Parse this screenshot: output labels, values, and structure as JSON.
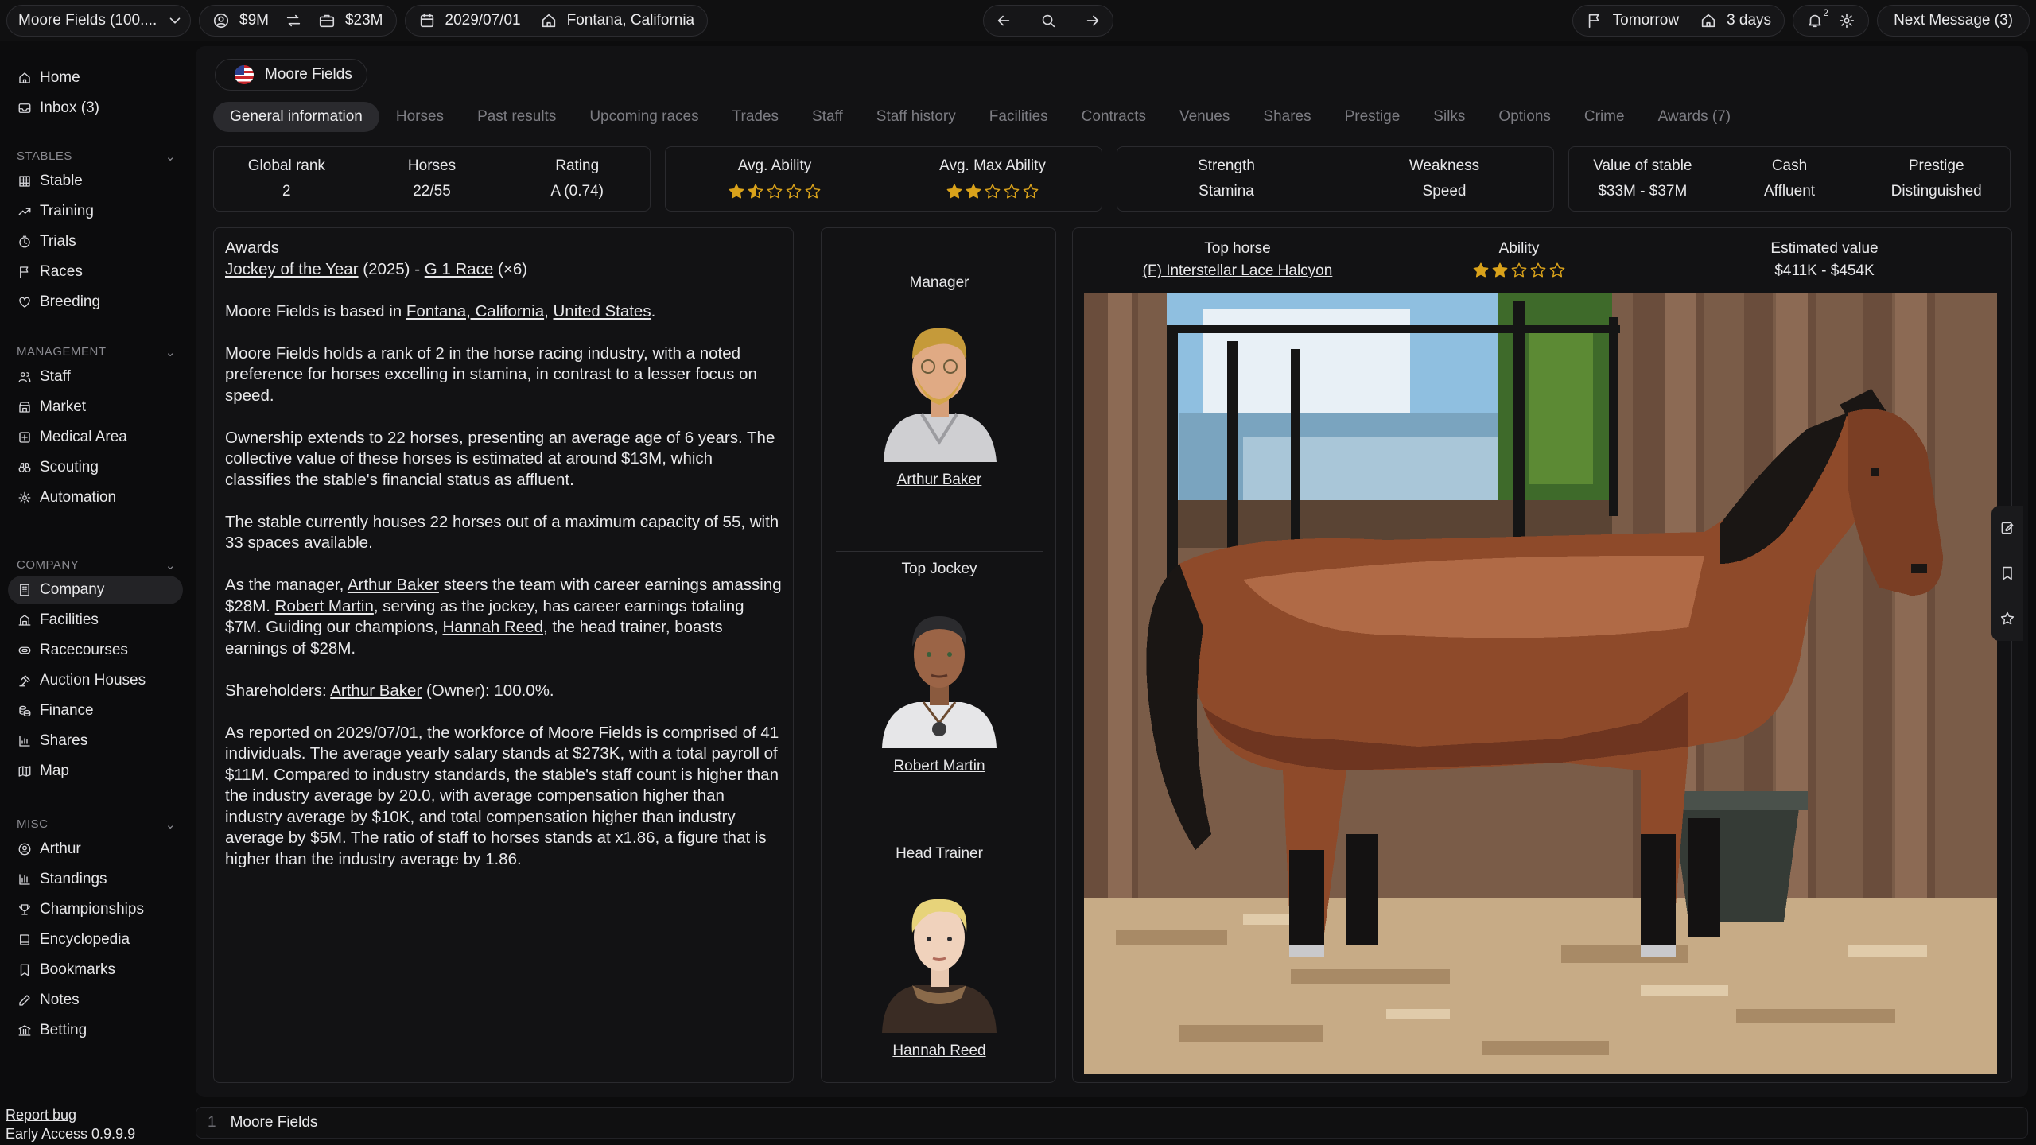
{
  "topbar": {
    "stable_select": "Moore Fields (100....",
    "money": "$9M",
    "stable_value": "$23M",
    "date": "2029/07/01",
    "location": "Fontana, California",
    "forecast": "Tomorrow",
    "days": "3 days",
    "notifications": "2",
    "next_message": "Next Message (3)"
  },
  "sidebar": {
    "top": [
      {
        "label": "Home",
        "icon": "home-icon"
      },
      {
        "label": "Inbox (3)",
        "icon": "inbox-icon"
      }
    ],
    "sections": [
      {
        "title": "STABLES",
        "items": [
          {
            "label": "Stable",
            "icon": "grid-icon"
          },
          {
            "label": "Training",
            "icon": "trend-icon"
          },
          {
            "label": "Trials",
            "icon": "stopwatch-icon"
          },
          {
            "label": "Races",
            "icon": "flag-icon"
          },
          {
            "label": "Breeding",
            "icon": "heart-icon"
          }
        ]
      },
      {
        "title": "MANAGEMENT",
        "items": [
          {
            "label": "Staff",
            "icon": "users-icon"
          },
          {
            "label": "Market",
            "icon": "store-icon"
          },
          {
            "label": "Medical Area",
            "icon": "medical-icon"
          },
          {
            "label": "Scouting",
            "icon": "binoculars-icon"
          },
          {
            "label": "Automation",
            "icon": "cog-icon"
          }
        ]
      },
      {
        "title": "COMPANY",
        "items": [
          {
            "label": "Company",
            "icon": "building-icon"
          },
          {
            "label": "Facilities",
            "icon": "facilities-icon"
          },
          {
            "label": "Racecourses",
            "icon": "racecourse-icon"
          },
          {
            "label": "Auction Houses",
            "icon": "gavel-icon"
          },
          {
            "label": "Finance",
            "icon": "coins-icon"
          },
          {
            "label": "Shares",
            "icon": "chart-icon"
          },
          {
            "label": "Map",
            "icon": "map-icon"
          }
        ]
      },
      {
        "title": "MISC",
        "items": [
          {
            "label": "Arthur",
            "icon": "user-circle-icon"
          },
          {
            "label": "Standings",
            "icon": "standings-icon"
          },
          {
            "label": "Championships",
            "icon": "trophy-icon"
          },
          {
            "label": "Encyclopedia",
            "icon": "book-icon"
          },
          {
            "label": "Bookmarks",
            "icon": "bookmark-icon"
          },
          {
            "label": "Notes",
            "icon": "note-icon"
          },
          {
            "label": "Betting",
            "icon": "bank-icon"
          }
        ]
      }
    ],
    "report_bug": "Report bug",
    "version": "Early Access 0.9.9.9"
  },
  "stable_chip": "Moore Fields",
  "tabs": [
    "General information",
    "Horses",
    "Past results",
    "Upcoming races",
    "Trades",
    "Staff",
    "Staff history",
    "Facilities",
    "Contracts",
    "Venues",
    "Shares",
    "Prestige",
    "Silks",
    "Options",
    "Crime",
    "Awards (7)"
  ],
  "stats": {
    "global_rank_label": "Global rank",
    "global_rank": "2",
    "horses_label": "Horses",
    "horses": "22/55",
    "rating_label": "Rating",
    "rating": "A (0.74)",
    "avg_ability_label": "Avg. Ability",
    "avg_ability_stars": 1.5,
    "avg_max_ability_label": "Avg. Max Ability",
    "avg_max_ability_stars": 2,
    "strength_label": "Strength",
    "strength": "Stamina",
    "weakness_label": "Weakness",
    "weakness": "Speed",
    "value_label": "Value of stable",
    "value": "$33M - $37M",
    "cash_label": "Cash",
    "cash": "Affluent",
    "prestige_label": "Prestige",
    "prestige": "Distinguished"
  },
  "about": {
    "awards_title": "Awards",
    "award_link": "Jockey of the Year",
    "award_year": " (2025) - ",
    "award_race": "G 1 Race",
    "award_count": " (×6)",
    "p1_a": "Moore Fields is based in ",
    "p1_city": "Fontana, California",
    "p1_b": ", ",
    "p1_country": "United States",
    "p1_c": ".",
    "p2": "Moore Fields holds a rank of 2 in the horse racing industry, with a noted preference for horses excelling in stamina, in contrast to a lesser focus on speed.",
    "p3": "Ownership extends to 22 horses, presenting an average age of 6 years. The collective value of these horses is estimated at around $13M, which classifies the stable's financial status as affluent.",
    "p4": "The stable currently houses 22 horses out of a maximum capacity of 55, with 33 spaces available.",
    "p5_a": "As the manager, ",
    "p5_manager": "Arthur Baker",
    "p5_b": " steers the team with career earnings amassing $28M. ",
    "p5_jockey": "Robert Martin",
    "p5_c": ", serving as the jockey, has career earnings totaling $7M. Guiding our champions, ",
    "p5_trainer": "Hannah Reed",
    "p5_d": ", the head trainer, boasts earnings of $28M.",
    "p6_a": "Shareholders: ",
    "p6_owner": "Arthur Baker",
    "p6_b": " (Owner): 100.0%.",
    "p7": "As reported on 2029/07/01, the workforce of Moore Fields is comprised of 41 individuals. The average yearly salary stands at $273K, with a total payroll of $11M. Compared to industry standards, the stable's staff count is higher than the industry average by 20.0, with average compensation higher than industry average by $10K, and total compensation higher than industry average by $5M. The ratio of staff to horses stands at x1.86, a figure that is higher than the industry average by 1.86."
  },
  "staff": [
    {
      "role": "Manager",
      "name": "Arthur Baker"
    },
    {
      "role": "Top Jockey",
      "name": "Robert Martin"
    },
    {
      "role": "Head Trainer",
      "name": "Hannah Reed"
    }
  ],
  "top_horse": {
    "label": "Top horse",
    "name": "(F) Interstellar Lace Halcyon",
    "ability_label": "Ability",
    "ability_stars": 2,
    "value_label": "Estimated value",
    "value": "$411K - $454K"
  },
  "bottom": {
    "index": "1",
    "label": "Moore Fields"
  },
  "colors": {
    "star": "#d9a21b",
    "background": "#0c0c0d",
    "panel": "#121214"
  }
}
